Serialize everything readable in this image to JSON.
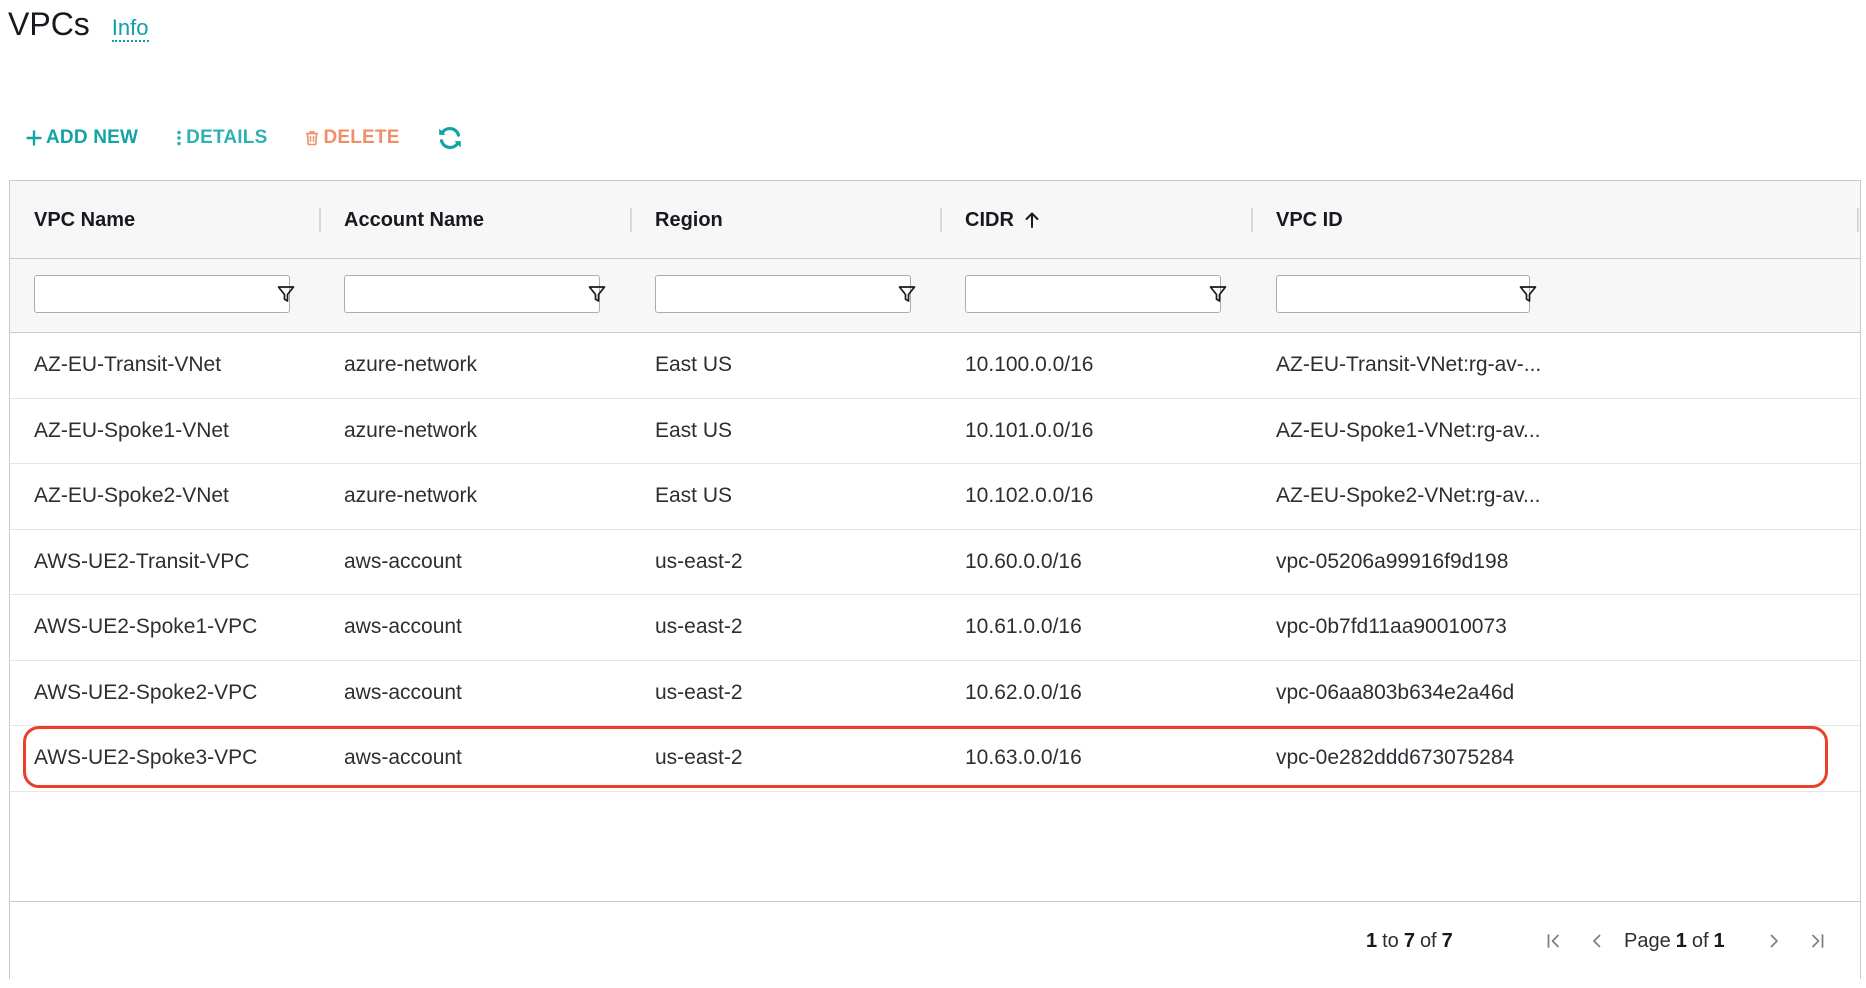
{
  "header": {
    "title": "VPCs",
    "info_link": "Info"
  },
  "toolbar": {
    "add_label": "ADD NEW",
    "add_icon": "plus-icon",
    "details_label": "DETAILS",
    "details_icon": "vertical-dots-icon",
    "delete_label": "DELETE",
    "delete_icon": "trash-icon",
    "refresh_icon": "refresh-icon"
  },
  "table": {
    "columns": [
      {
        "label": "VPC Name"
      },
      {
        "label": "Account Name"
      },
      {
        "label": "Region"
      },
      {
        "label": "CIDR",
        "sort": "ascending"
      },
      {
        "label": "VPC ID"
      }
    ],
    "filter_placeholder": "",
    "rows": [
      {
        "vpc_name": "AZ-EU-Transit-VNet",
        "account": "azure-network",
        "region": "East US",
        "cidr": "10.100.0.0/16",
        "vpc_id": "AZ-EU-Transit-VNet:rg-av-..."
      },
      {
        "vpc_name": "AZ-EU-Spoke1-VNet",
        "account": "azure-network",
        "region": "East US",
        "cidr": "10.101.0.0/16",
        "vpc_id": "AZ-EU-Spoke1-VNet:rg-av..."
      },
      {
        "vpc_name": "AZ-EU-Spoke2-VNet",
        "account": "azure-network",
        "region": "East US",
        "cidr": "10.102.0.0/16",
        "vpc_id": "AZ-EU-Spoke2-VNet:rg-av..."
      },
      {
        "vpc_name": "AWS-UE2-Transit-VPC",
        "account": "aws-account",
        "region": "us-east-2",
        "cidr": "10.60.0.0/16",
        "vpc_id": "vpc-05206a99916f9d198"
      },
      {
        "vpc_name": "AWS-UE2-Spoke1-VPC",
        "account": "aws-account",
        "region": "us-east-2",
        "cidr": "10.61.0.0/16",
        "vpc_id": "vpc-0b7fd11aa90010073"
      },
      {
        "vpc_name": "AWS-UE2-Spoke2-VPC",
        "account": "aws-account",
        "region": "us-east-2",
        "cidr": "10.62.0.0/16",
        "vpc_id": "vpc-06aa803b634e2a46d"
      },
      {
        "vpc_name": "AWS-UE2-Spoke3-VPC",
        "account": "aws-account",
        "region": "us-east-2",
        "cidr": "10.63.0.0/16",
        "vpc_id": "vpc-0e282ddd673075284",
        "highlighted": true
      }
    ]
  },
  "pagination": {
    "range_from": "1",
    "range_to_word": "to",
    "range_to": "7",
    "range_of_word": "of",
    "range_total": "7",
    "page_word": "Page",
    "page_current": "1",
    "page_of_word": "of",
    "page_total": "1"
  },
  "colors": {
    "accent": "#12a3a5",
    "delete": "#ef8f67",
    "highlight_border": "#e8402b",
    "header_bg": "#f7f7f7"
  }
}
